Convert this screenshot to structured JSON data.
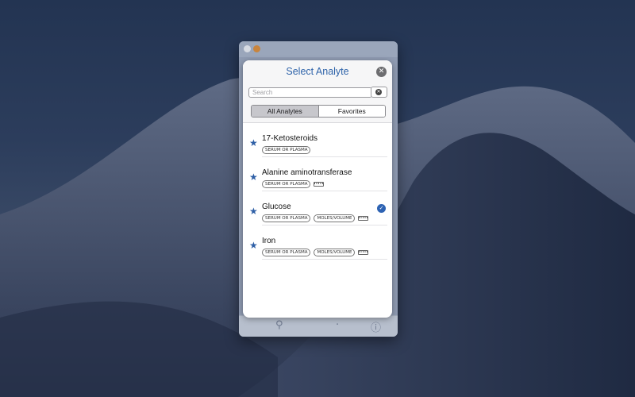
{
  "sheet": {
    "title": "Select Analyte",
    "search_placeholder": "Search",
    "segments": [
      {
        "label": "All Analytes",
        "selected": true
      },
      {
        "label": "Favorites",
        "selected": false
      }
    ]
  },
  "analytes": [
    {
      "name": "17-Ketosteroids",
      "tags": [
        "SERUM OR PLASMA"
      ],
      "ruler": false,
      "selected": false
    },
    {
      "name": "Alanine aminotransferase",
      "tags": [
        "SERUM OR PLASMA"
      ],
      "ruler": true,
      "selected": false
    },
    {
      "name": "Glucose",
      "tags": [
        "SERUM OR PLASMA",
        "MOLES/VOLUME"
      ],
      "ruler": true,
      "selected": true
    },
    {
      "name": "Iron",
      "tags": [
        "SERUM OR PLASMA",
        "MOLES/VOLUME"
      ],
      "ruler": true,
      "selected": false
    }
  ],
  "icons": {
    "star": "star-icon",
    "check": "checkmark-icon",
    "ruler": "ruler-icon",
    "close": "close-icon",
    "clear": "clear-icon"
  },
  "colors": {
    "accent": "#2e63a9",
    "star": "#2e5fa6"
  }
}
